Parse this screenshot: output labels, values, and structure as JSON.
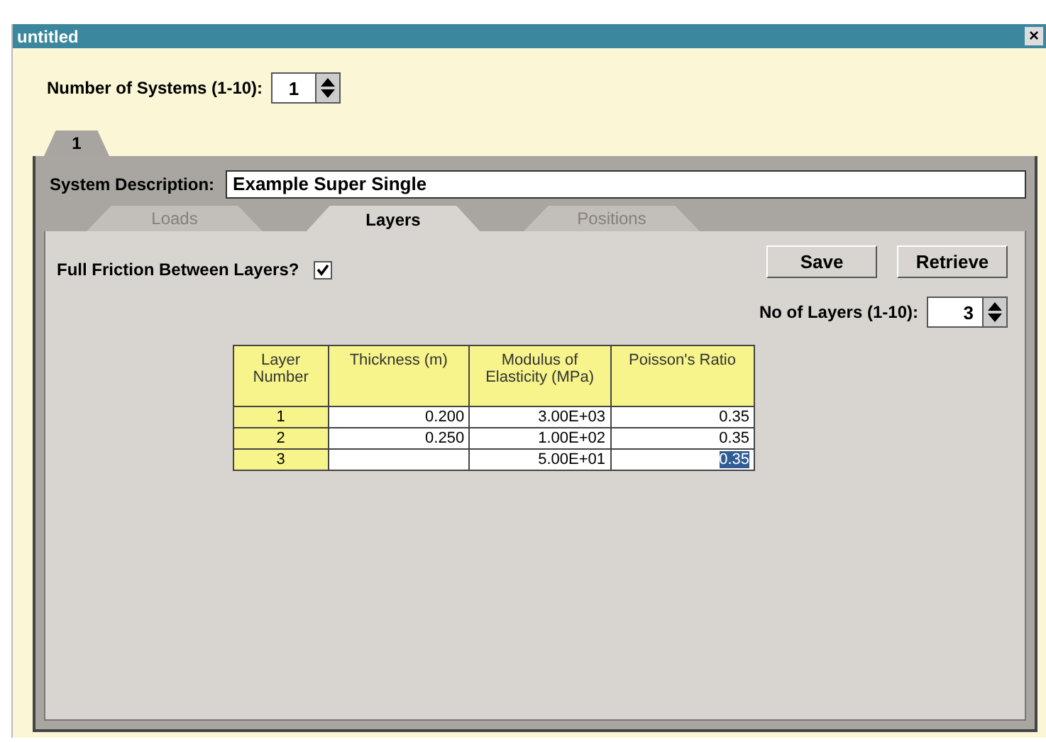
{
  "window": {
    "title": "untitled",
    "close": "×"
  },
  "systems": {
    "label": "Number of Systems (1-10):",
    "value": "1"
  },
  "system_tabs": [
    {
      "label": "1",
      "selected": true
    }
  ],
  "description": {
    "label": "System Description:",
    "value": "Example Super Single"
  },
  "tabs": [
    {
      "label": "Loads",
      "selected": false,
      "disabled": true
    },
    {
      "label": "Layers",
      "selected": true,
      "disabled": false
    },
    {
      "label": "Positions",
      "selected": false,
      "disabled": true
    }
  ],
  "friction": {
    "label": "Full Friction Between Layers?",
    "checked": true
  },
  "buttons": [
    "Save",
    "Retrieve"
  ],
  "layers_count": {
    "label": "No of Layers (1-10):",
    "value": "3"
  },
  "table": {
    "columns": [
      "Layer Number",
      "Thickness (m)",
      "Modulus of Elasticity (MPa)",
      "Poisson's Ratio"
    ],
    "rows": [
      {
        "number": "1",
        "thickness": "0.200",
        "modulus": "3.00E+03",
        "poisson": {
          "value": "0.35",
          "selected": false
        }
      },
      {
        "number": "2",
        "thickness": "0.250",
        "modulus": "1.00E+02",
        "poisson": {
          "value": "0.35",
          "selected": false
        }
      },
      {
        "number": "3",
        "modulus": "5.00E+01",
        "poisson": {
          "value": "0.35",
          "selected": true
        }
      }
    ]
  }
}
